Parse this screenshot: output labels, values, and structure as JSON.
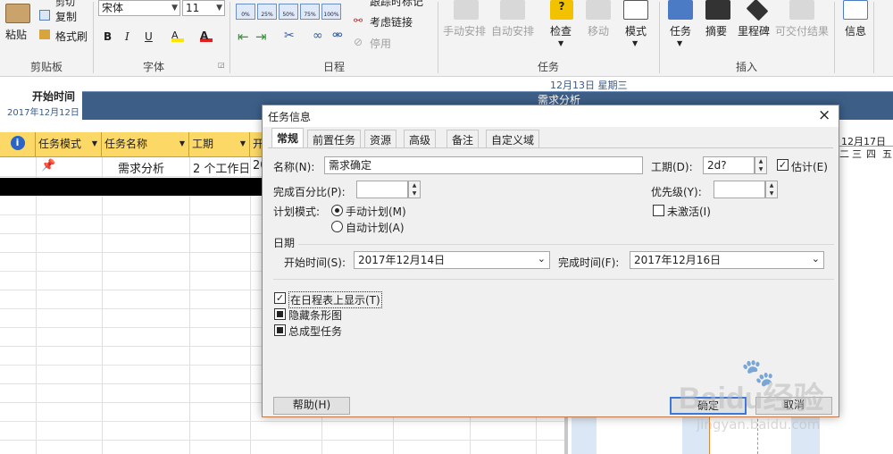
{
  "ribbon": {
    "clipboard": {
      "paste": "粘贴",
      "copy": "复制",
      "format_painter": "格式刷",
      "cut_partial": "剪切",
      "group": "剪贴板"
    },
    "font": {
      "name": "宋体",
      "size": "11",
      "bold": "B",
      "italic": "I",
      "underline": "U",
      "highlight": "A",
      "color": "A",
      "group": "字体"
    },
    "schedule": {
      "pct": [
        "0%",
        "25%",
        "50%",
        "75%",
        "100%"
      ],
      "track": "跟踪时标记",
      "respect_links": "考虑链接",
      "inactivate": "停用",
      "group": "日程"
    },
    "tasks": {
      "manual": "手动安排",
      "auto": "自动安排",
      "inspect": "检查",
      "move": "移动",
      "mode": "模式",
      "group": "任务"
    },
    "insert": {
      "task": "任务",
      "summary": "摘要",
      "milestone": "里程碑",
      "deliverable": "可交付结果",
      "group": "插入"
    },
    "info": "信息"
  },
  "timeline": {
    "start_label": "开始时间",
    "start_date": "2017年12月12日",
    "date_marker": "12月13日 星期三",
    "bar_label": "需求分析"
  },
  "grid": {
    "headers": [
      "任务模式",
      "任务名称",
      "工期",
      "开"
    ],
    "row1": {
      "name": "需求分析",
      "duration": "2 个工作日",
      "start_partial": "20"
    }
  },
  "gantt": {
    "week_label": "12月17日",
    "days": [
      "二",
      "三",
      "四",
      "五"
    ]
  },
  "dialog": {
    "title": "任务信息",
    "tabs": [
      "常规",
      "前置任务",
      "资源",
      "高级",
      "备注",
      "自定义域"
    ],
    "name_label": "名称(N):",
    "name_value": "需求确定",
    "duration_label": "工期(D):",
    "duration_value": "2d?",
    "estimated_label": "估计(E)",
    "percent_label": "完成百分比(P):",
    "percent_value": "",
    "priority_label": "优先级(Y):",
    "priority_value": "",
    "mode_label": "计划模式:",
    "manual_label": "手动计划(M)",
    "auto_label": "自动计划(A)",
    "inactive_label": "未激活(I)",
    "dates_group": "日期",
    "start_label": "开始时间(S):",
    "start_value": "2017年12月14日",
    "finish_label": "完成时间(F):",
    "finish_value": "2017年12月16日",
    "show_timeline": "在日程表上显示(T)",
    "hide_bar": "隐藏条形图",
    "summary_task": "总成型任务",
    "help": "帮助(H)",
    "ok": "确定",
    "cancel": "取消",
    "close": "×"
  },
  "watermark": {
    "brand": "Baidu经验",
    "url": "jingyan.baidu.com"
  }
}
